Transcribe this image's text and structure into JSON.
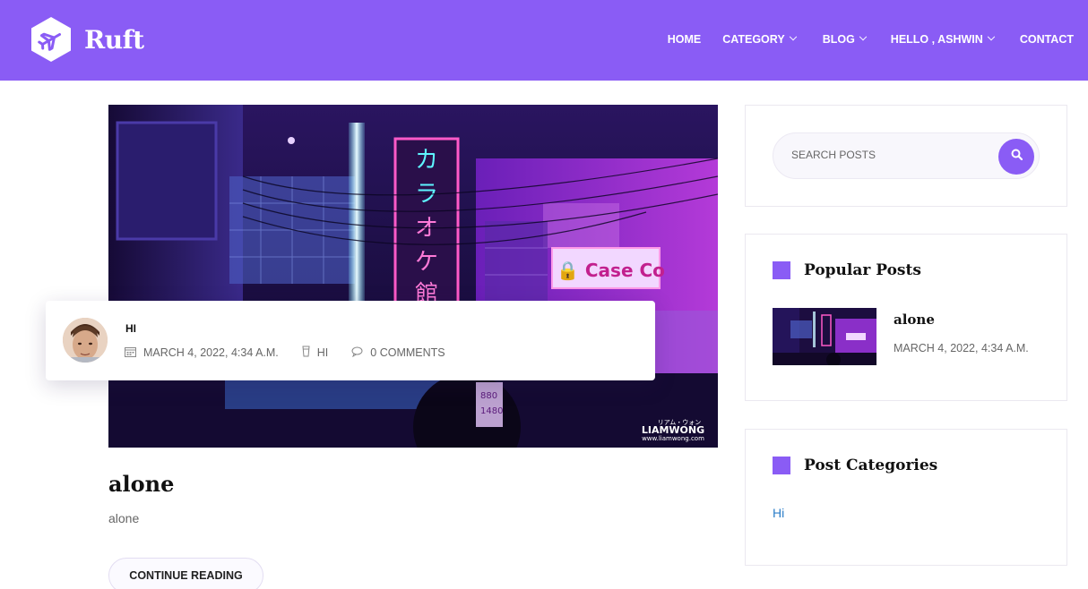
{
  "brand": {
    "name": "Ruft",
    "accent": "#8a5cf5"
  },
  "nav": {
    "items": [
      {
        "label": "HOME",
        "dropdown": false
      },
      {
        "label": "CATEGORY",
        "dropdown": true
      },
      {
        "label": "BLOG",
        "dropdown": true
      },
      {
        "label": "HELLO , ASHWIN",
        "dropdown": true
      },
      {
        "label": "CONTACT",
        "dropdown": false
      }
    ]
  },
  "post": {
    "author": "HI",
    "date": "MARCH 4, 2022, 4:34 A.M.",
    "author_meta": "HI",
    "comments": "0 COMMENTS",
    "title": "alone",
    "excerpt": "alone",
    "read_more": "CONTINUE READING",
    "image_watermark": "LIAMWONG",
    "image_watermark_sub": "www.liamwong.com",
    "image_watermark_jp": "リアム・ウォン"
  },
  "sidebar": {
    "search": {
      "placeholder": "SEARCH POSTS",
      "icon": "search-icon"
    },
    "popular": {
      "title": "Popular Posts",
      "items": [
        {
          "title": "alone",
          "date": "MARCH 4, 2022, 4:34 A.M."
        }
      ]
    },
    "categories": {
      "title": "Post Categories",
      "items": [
        "Hi"
      ]
    }
  },
  "colors": {
    "header_bg": "#8a5cf5",
    "link": "#2c7ec9",
    "text_muted": "#666666"
  }
}
